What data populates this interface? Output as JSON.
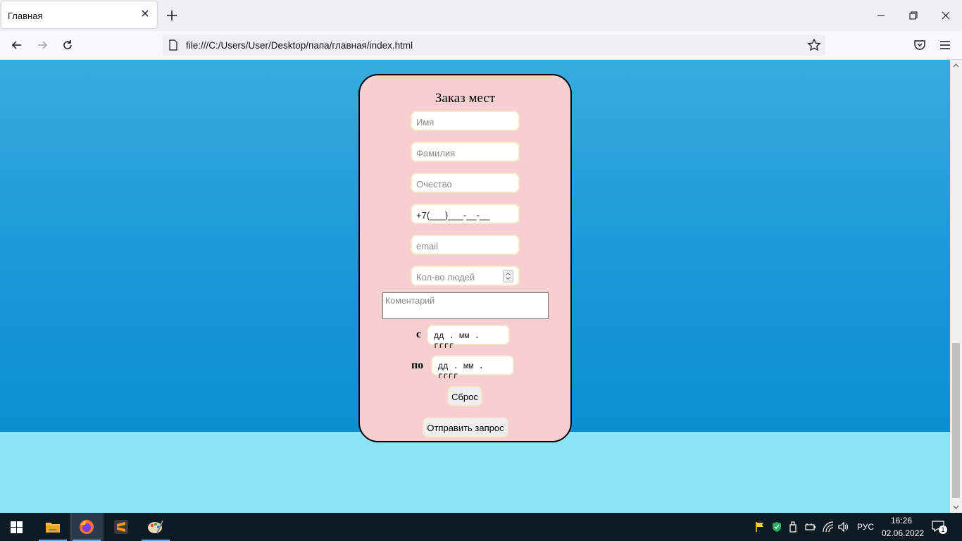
{
  "browser": {
    "tab_title": "Главная",
    "url": "file:///C:/Users/User/Desktop/папа/главная/index.html"
  },
  "form": {
    "title": "Заказ мест",
    "first_name_placeholder": "Имя",
    "last_name_placeholder": "Фамилия",
    "patronymic_placeholder": "Очество",
    "phone_value": "+7(___)___-__-__",
    "email_placeholder": "email",
    "people_count_placeholder": "Кол-во людей",
    "comment_placeholder": "Коментарий",
    "from_label": "с",
    "to_label": "по",
    "date_placeholder": "дд . мм . гггг",
    "reset_label": "Сброс",
    "submit_label": "Отправить запрос"
  },
  "taskbar": {
    "language": "РУС",
    "time": "16:26",
    "date": "02.06.2022",
    "notification_count": "1"
  }
}
